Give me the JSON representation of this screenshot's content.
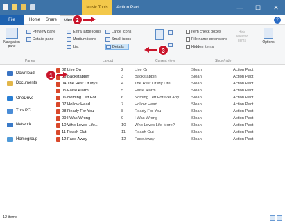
{
  "titlebar": {
    "context_tab": "Music Tools",
    "title": "Action Pact",
    "minimize": "—",
    "maximize": "☐",
    "close": "✕"
  },
  "ribbon_tabs": {
    "file": "File",
    "home": "Home",
    "share": "Share",
    "view": "View"
  },
  "ribbon": {
    "navigation_pane": "Navigation pane",
    "preview_pane": "Preview pane",
    "details_pane": "Details pane",
    "panes_label": "Panes",
    "extra_large_icons": "Extra large icons",
    "large_icons": "Large icons",
    "medium_icons": "Medium icons",
    "small_icons": "Small icons",
    "list": "List",
    "details": "Details",
    "layout_label": "Layout",
    "current_view_label": "Current view",
    "item_check_boxes": "Item check boxes",
    "file_name_extensions": "File name extensions",
    "hidden_items": "Hidden items",
    "hide_selected_items": "Hide selected items",
    "options": "Options",
    "show_hide_label": "Show/hide"
  },
  "nav": {
    "items": [
      {
        "label": "Download",
        "color": "#3a74c4"
      },
      {
        "label": "Documents",
        "color": "#e2b64a"
      },
      {
        "label": "OneDrive",
        "color": "#2a7fd4"
      },
      {
        "label": "This PC",
        "color": "#4a8cd6"
      },
      {
        "label": "Network",
        "color": "#3a7ac8"
      },
      {
        "label": "Homegroup",
        "color": "#4f9ad8"
      }
    ]
  },
  "files": [
    {
      "name": "02 Live On",
      "num": "2",
      "title": "Live On",
      "artist": "Sloan",
      "album": "Action Pact"
    },
    {
      "name": "03 Backstabbin'",
      "num": "3",
      "title": "Backstabbin'",
      "artist": "Sloan",
      "album": "Action Pact"
    },
    {
      "name": "04 The Rest Of My L...",
      "num": "4",
      "title": "The Rest Of My Life",
      "artist": "Sloan",
      "album": "Action Pact"
    },
    {
      "name": "05 False Alarm",
      "num": "5",
      "title": "False Alarm",
      "artist": "Sloan",
      "album": "Action Pact"
    },
    {
      "name": "06 Nothing Left For...",
      "num": "6",
      "title": "Nothing Left Forever Any...",
      "artist": "Sloan",
      "album": "Action Pact"
    },
    {
      "name": "07 Hollow Head",
      "num": "7",
      "title": "Hollow Head",
      "artist": "Sloan",
      "album": "Action Pact"
    },
    {
      "name": "08 Ready For You",
      "num": "8",
      "title": "Ready For You",
      "artist": "Sloan",
      "album": "Action Pact"
    },
    {
      "name": "09 I Was Wrong",
      "num": "9",
      "title": "I Was Wrong",
      "artist": "Sloan",
      "album": "Action Pact"
    },
    {
      "name": "10 Who Loves Life...",
      "num": "10",
      "title": "Who Loves Life More?",
      "artist": "Sloan",
      "album": "Action Pact"
    },
    {
      "name": "11 Reach Out",
      "num": "11",
      "title": "Reach Out",
      "artist": "Sloan",
      "album": "Action Pact"
    },
    {
      "name": "12 Fade Away",
      "num": "12",
      "title": "Fade Away",
      "artist": "Sloan",
      "album": "Action Pact"
    }
  ],
  "status": {
    "items": "12 items"
  },
  "callouts": {
    "one": "1",
    "two": "2",
    "three": "3"
  },
  "colors": {
    "callout": "#c9142a",
    "titlebar": "#3d73a8",
    "file_tab": "#1e62b0",
    "context_tab": "#f3c84a"
  }
}
